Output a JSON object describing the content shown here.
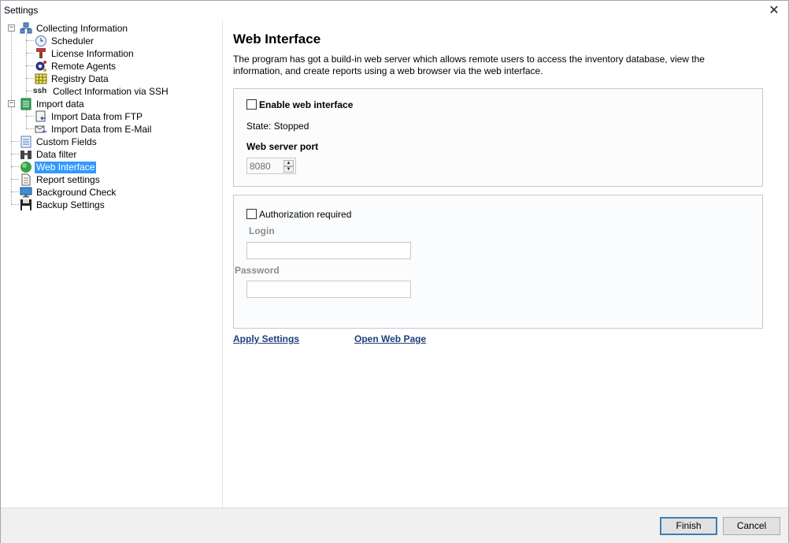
{
  "window": {
    "title": "Settings",
    "close_glyph": "✕"
  },
  "tree": {
    "items": [
      {
        "label": "Collecting Information",
        "icon": "network-icon"
      },
      {
        "label": "Scheduler",
        "icon": "clock-icon"
      },
      {
        "label": "License Information",
        "icon": "license-stamp-icon"
      },
      {
        "label": "Remote Agents",
        "icon": "gear-agents-icon"
      },
      {
        "label": "Registry Data",
        "icon": "registry-grid-icon"
      },
      {
        "label": "Collect Information via SSH",
        "icon": "ssh-icon",
        "icon_text": "ssh"
      },
      {
        "label": "Import data",
        "icon": "import-icon"
      },
      {
        "label": "Import Data from FTP",
        "icon": "ftp-import-icon"
      },
      {
        "label": "Import Data from E-Mail",
        "icon": "email-import-icon"
      },
      {
        "label": "Custom Fields",
        "icon": "list-icon"
      },
      {
        "label": "Data filter",
        "icon": "binoculars-icon"
      },
      {
        "label": "Web Interface",
        "icon": "globe-icon",
        "selected": true
      },
      {
        "label": "Report settings",
        "icon": "document-icon"
      },
      {
        "label": "Background Check",
        "icon": "monitor-icon"
      },
      {
        "label": "Backup Settings",
        "icon": "floppy-icon"
      }
    ]
  },
  "main": {
    "title": "Web Interface",
    "description": "The program has got a build-in web server which allows remote users to access the inventory database, view the information, and create reports using a web browser via the web interface.",
    "enable_label": "Enable web interface",
    "state_text": "State: Stopped",
    "port_label": "Web server port",
    "port_value": "8080",
    "auth_label": "Authorization required",
    "login_label": "Login",
    "login_value": "",
    "password_label": "Password",
    "password_value": "",
    "apply_link": "Apply Settings",
    "open_link": "Open Web Page"
  },
  "footer": {
    "finish_label": "Finish",
    "cancel_label": "Cancel"
  },
  "colors": {
    "selection": "#3399ff",
    "link": "#1c3f7a",
    "footer_bg": "#f0f0f0"
  }
}
